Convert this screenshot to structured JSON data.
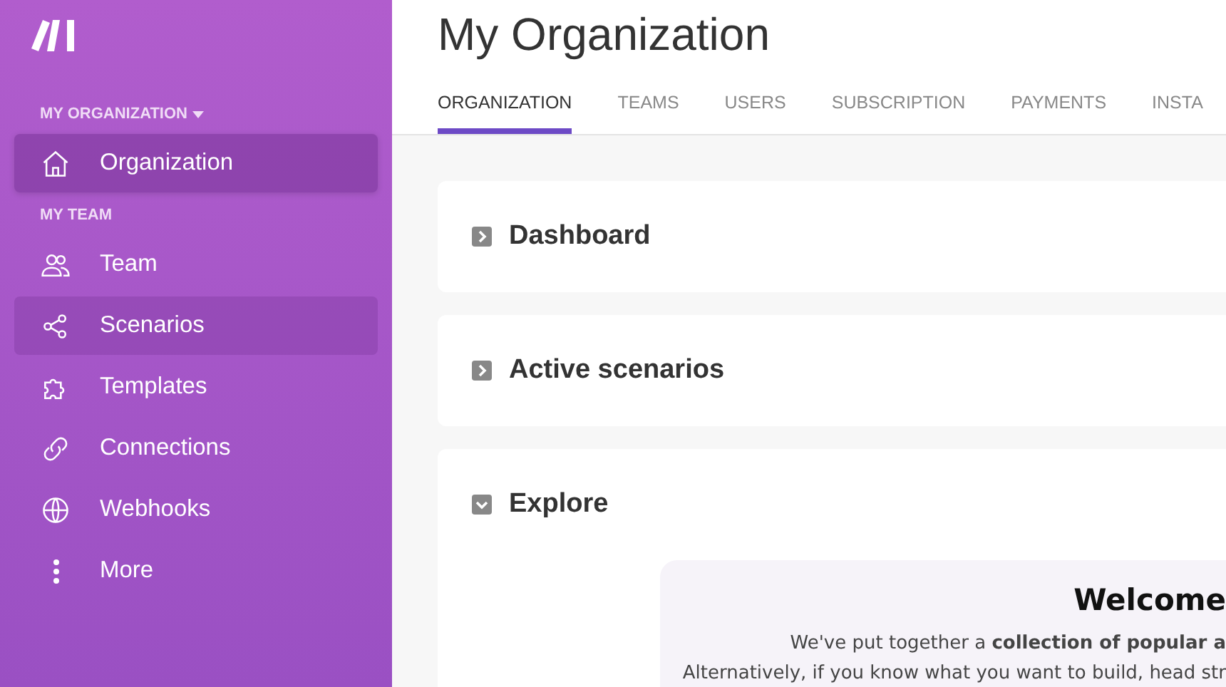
{
  "sidebar": {
    "org_heading": "MY ORGANIZATION",
    "team_heading": "MY TEAM",
    "org_items": [
      {
        "label": "Organization",
        "selected": true
      }
    ],
    "team_items": [
      {
        "label": "Team",
        "selected": false,
        "hovered": false
      },
      {
        "label": "Scenarios",
        "selected": false,
        "hovered": true
      },
      {
        "label": "Templates",
        "selected": false,
        "hovered": false
      },
      {
        "label": "Connections",
        "selected": false,
        "hovered": false
      },
      {
        "label": "Webhooks",
        "selected": false,
        "hovered": false
      },
      {
        "label": "More",
        "selected": false,
        "hovered": false
      }
    ]
  },
  "page": {
    "title": "My Organization",
    "tabs": [
      {
        "label": "ORGANIZATION",
        "selected": true
      },
      {
        "label": "TEAMS",
        "selected": false
      },
      {
        "label": "USERS",
        "selected": false
      },
      {
        "label": "SUBSCRIPTION",
        "selected": false
      },
      {
        "label": "PAYMENTS",
        "selected": false
      },
      {
        "label": "INSTA",
        "selected": false
      }
    ],
    "sections": [
      {
        "title": "Dashboard",
        "expanded": false
      },
      {
        "title": "Active scenarios",
        "expanded": false
      },
      {
        "title": "Explore",
        "expanded": true
      }
    ],
    "welcome": {
      "heading": "Welcome",
      "lines": [
        "We've put together a **collection of popular a**",
        "Alternatively, if you know what you want to build, head str"
      ]
    }
  }
}
